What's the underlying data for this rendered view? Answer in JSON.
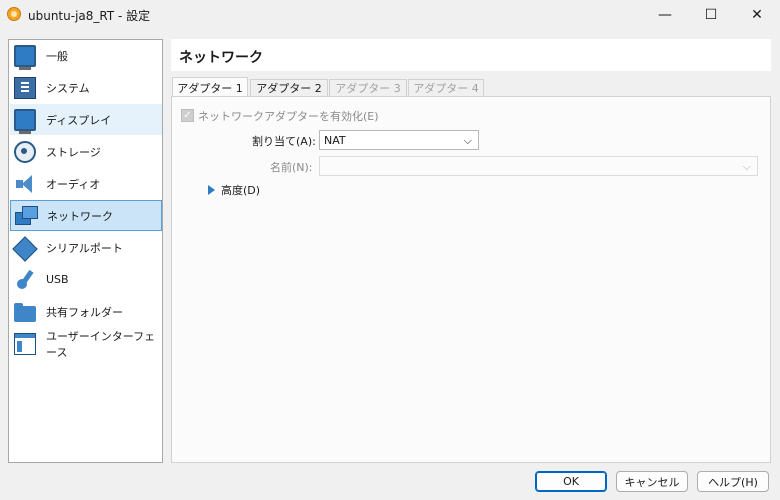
{
  "window": {
    "title": "ubuntu-ja8_RT - 設定",
    "minimize": "—",
    "maximize": "☐",
    "close": "✕"
  },
  "sidebar": {
    "items": [
      {
        "label": "一般",
        "icon": "monitor-icon"
      },
      {
        "label": "システム",
        "icon": "system-icon"
      },
      {
        "label": "ディスプレイ",
        "icon": "display-icon"
      },
      {
        "label": "ストレージ",
        "icon": "storage-icon"
      },
      {
        "label": "オーディオ",
        "icon": "audio-icon"
      },
      {
        "label": "ネットワーク",
        "icon": "network-icon"
      },
      {
        "label": "シリアルポート",
        "icon": "serial-port-icon"
      },
      {
        "label": "USB",
        "icon": "usb-icon"
      },
      {
        "label": "共有フォルダー",
        "icon": "shared-folder-icon"
      },
      {
        "label": "ユーザーインターフェース",
        "icon": "user-interface-icon"
      }
    ],
    "selected": "ネットワーク"
  },
  "page": {
    "title": "ネットワーク",
    "tabs": [
      {
        "label": "アダプター 1",
        "state": "active"
      },
      {
        "label": "アダプター 2",
        "state": "enabled"
      },
      {
        "label": "アダプター 3",
        "state": "disabled"
      },
      {
        "label": "アダプター 4",
        "state": "disabled"
      }
    ],
    "enable_adapter": {
      "label": "ネットワークアダプターを有効化(E)",
      "checked": true,
      "check_mark": "✓"
    },
    "attached_to": {
      "label": "割り当て(A):",
      "value": "NAT",
      "chevron": "⌵"
    },
    "name": {
      "label": "名前(N):",
      "value": "",
      "chevron": "⌵"
    },
    "advanced": {
      "label": "高度(D)"
    }
  },
  "buttons": {
    "ok": "OK",
    "cancel": "キャンセル",
    "help": "ヘルプ(H)"
  },
  "colors": {
    "accent": "#2f7bc4",
    "selection": "#cce4f7",
    "selection_border": "#5aa0d8"
  }
}
